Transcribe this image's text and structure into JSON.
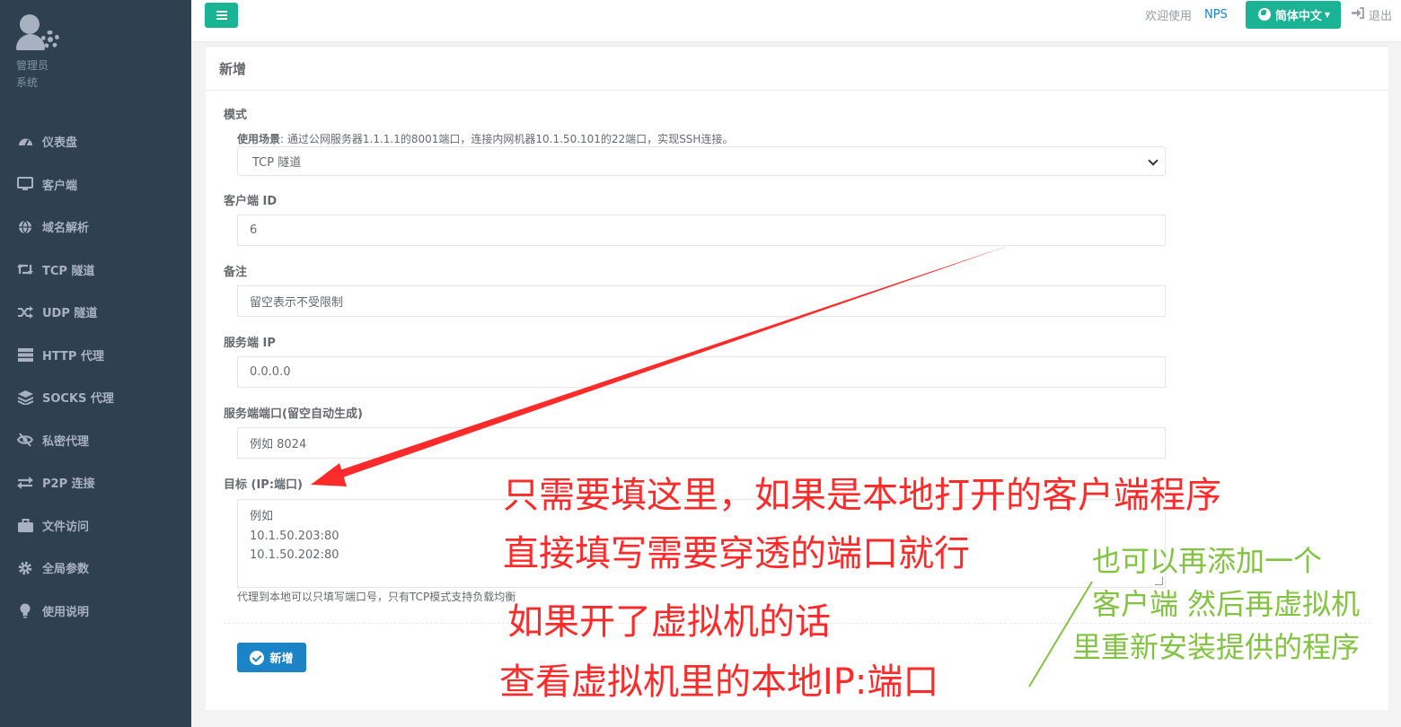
{
  "sidebar": {
    "profile": {
      "role": "管理员",
      "sub": "系统"
    },
    "items": [
      {
        "label": "仪表盘",
        "icon": "dashboard-icon"
      },
      {
        "label": "客户端",
        "icon": "desktop-icon"
      },
      {
        "label": "域名解析",
        "icon": "globe-icon"
      },
      {
        "label": "TCP 隧道",
        "icon": "retweet-icon"
      },
      {
        "label": "UDP 隧道",
        "icon": "random-icon"
      },
      {
        "label": "HTTP 代理",
        "icon": "server-icon"
      },
      {
        "label": "SOCKS 代理",
        "icon": "layers-icon"
      },
      {
        "label": "私密代理",
        "icon": "eye-slash-icon"
      },
      {
        "label": "P2P 连接",
        "icon": "exchange-icon"
      },
      {
        "label": "文件访问",
        "icon": "briefcase-icon"
      },
      {
        "label": "全局参数",
        "icon": "cog-icon"
      },
      {
        "label": "使用说明",
        "icon": "lightbulb-icon"
      }
    ]
  },
  "header": {
    "welcome": "欢迎使用",
    "brand": "NPS",
    "language": "简体中文",
    "logout": "退出"
  },
  "form": {
    "title": "新增",
    "mode_label": "模式",
    "usage_label": "使用场景",
    "usage_text": ": 通过公网服务器1.1.1.1的8001端口，连接内网机器10.1.50.101的22端口，实现SSH连接。",
    "mode_value": "TCP 隧道",
    "client_id_label": "客户端 ID",
    "client_id_value": "6",
    "remark_label": "备注",
    "remark_placeholder": "留空表示不受限制",
    "server_ip_label": "服务端 IP",
    "server_ip_value": "0.0.0.0",
    "server_port_label": "服务端端口(留空自动生成)",
    "server_port_placeholder": "例如 8024",
    "target_label": "目标 (IP:端口)",
    "target_placeholder": [
      "例如",
      "10.1.50.203:80",
      "10.1.50.202:80"
    ],
    "target_help": "代理到本地可以只填写端口号，只有TCP模式支持负载均衡",
    "submit_label": "新增"
  },
  "annotations": {
    "red_1": "只需要填这里，如果是本地打开的客户端程序",
    "red_2": "直接填写需要穿透的端口就行",
    "red_3": "如果开了虚拟机的话",
    "red_4": "查看虚拟机里的本地IP:端口",
    "green_1": "也可以再添加一个",
    "green_2": "客户端 然后再虚拟机",
    "green_3": "里重新安装提供的程序",
    "red_color": "#ff2a2a",
    "green_color": "#82c341"
  }
}
